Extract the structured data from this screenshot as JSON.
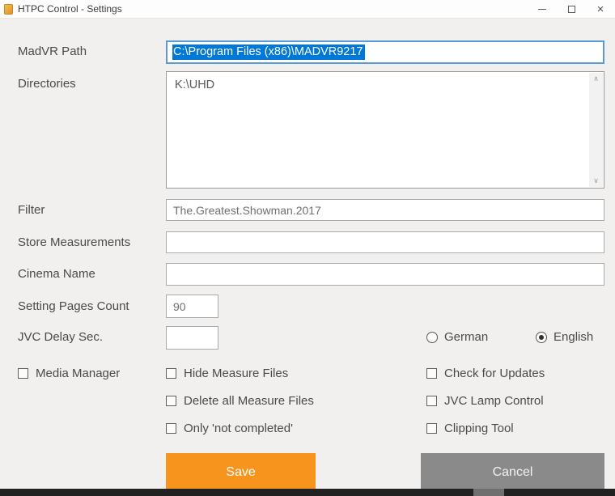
{
  "window": {
    "title": "HTPC Control - Settings",
    "icons": {
      "close_glyph": "×"
    }
  },
  "form": {
    "madvr_path": {
      "label": "MadVR Path",
      "value": "C:\\Program Files (x86)\\MADVR9217"
    },
    "directories": {
      "label": "Directories",
      "value": "K:\\UHD",
      "scroll_up_glyph": "∧",
      "scroll_down_glyph": "∨"
    },
    "filter": {
      "label": "Filter",
      "value": "The.Greatest.Showman.2017"
    },
    "store_measurements": {
      "label": "Store Measurements",
      "value": ""
    },
    "cinema_name": {
      "label": "Cinema Name",
      "value": ""
    },
    "setting_pages_count": {
      "label": "Setting Pages Count",
      "value": "90"
    },
    "jvc_delay_sec": {
      "label": "JVC Delay Sec.",
      "value": ""
    }
  },
  "language": {
    "german": {
      "label": "German",
      "selected": false
    },
    "english": {
      "label": "English",
      "selected": true
    }
  },
  "checkboxes": {
    "media_manager": {
      "label": "Media Manager",
      "checked": false
    },
    "hide_measure_files": {
      "label": "Hide Measure Files",
      "checked": false
    },
    "delete_all_measure_files": {
      "label": "Delete all Measure Files",
      "checked": false
    },
    "only_not_completed": {
      "label": "Only 'not completed'",
      "checked": false
    },
    "check_for_updates": {
      "label": "Check for Updates",
      "checked": false
    },
    "jvc_lamp_control": {
      "label": "JVC Lamp Control",
      "checked": false
    },
    "clipping_tool": {
      "label": "Clipping Tool",
      "checked": false
    }
  },
  "buttons": {
    "save": "Save",
    "cancel": "Cancel"
  },
  "colors": {
    "save_orange": "#F7941E",
    "cancel_gray": "#8A8A8A",
    "focus_border_blue": "#5B9BD5",
    "selection_blue": "#0078D7"
  }
}
